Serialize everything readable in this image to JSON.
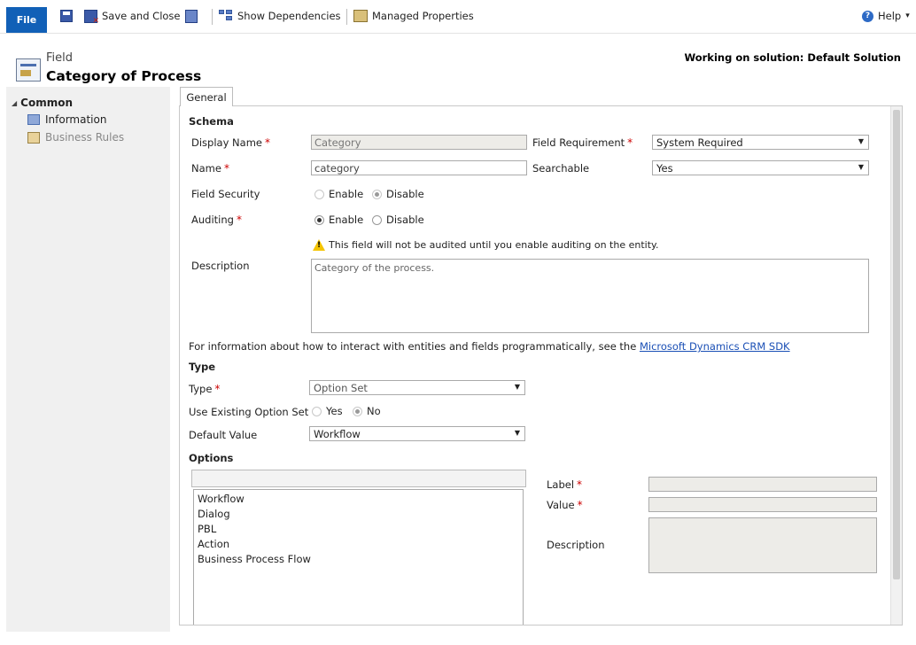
{
  "ribbon": {
    "file_label": "File",
    "save_and_close_label": "Save and Close",
    "show_dependencies_label": "Show Dependencies",
    "managed_properties_label": "Managed Properties",
    "help_label": "Help",
    "help_icon_glyph": "?",
    "help_caret": "▾"
  },
  "header": {
    "kind": "Field",
    "title": "Category of Process",
    "solution": "Working on solution: Default Solution"
  },
  "nav": {
    "section": "Common",
    "items": [
      {
        "label": "Information",
        "enabled": true
      },
      {
        "label": "Business Rules",
        "enabled": false
      }
    ]
  },
  "tab": {
    "label": "General"
  },
  "schema": {
    "section_label": "Schema",
    "display_name": {
      "label": "Display Name",
      "value": "Category"
    },
    "name": {
      "label": "Name",
      "value": "category"
    },
    "field_requirement": {
      "label": "Field Requirement",
      "value": "System Required"
    },
    "searchable": {
      "label": "Searchable",
      "value": "Yes"
    },
    "field_security": {
      "label": "Field Security",
      "enable": "Enable",
      "disable": "Disable",
      "selected": "Disable"
    },
    "auditing": {
      "label": "Auditing",
      "enable": "Enable",
      "disable": "Disable",
      "selected": "Enable"
    },
    "audit_warning": "This field will not be audited until you enable auditing on the entity.",
    "description": {
      "label": "Description",
      "value": "Category of the process."
    }
  },
  "sdk_note": {
    "text": "For information about how to interact with entities and fields programmatically, see the ",
    "link": "Microsoft Dynamics CRM SDK"
  },
  "type_section": {
    "section_label": "Type",
    "type": {
      "label": "Type",
      "value": "Option Set"
    },
    "use_existing": {
      "label": "Use Existing Option Set",
      "yes": "Yes",
      "no": "No",
      "selected": "No"
    },
    "default_value": {
      "label": "Default Value",
      "value": "Workflow"
    }
  },
  "options": {
    "section_label": "Options",
    "items": [
      "Workflow",
      "Dialog",
      "PBL",
      "Action",
      "Business Process Flow"
    ],
    "label_field": {
      "label": "Label",
      "value": ""
    },
    "value_field": {
      "label": "Value",
      "value": ""
    },
    "description_field": {
      "label": "Description",
      "value": ""
    }
  },
  "colors": {
    "file_button": "#1160b7",
    "required_asterisk": "#cc0000",
    "link": "#1a4fb5"
  }
}
